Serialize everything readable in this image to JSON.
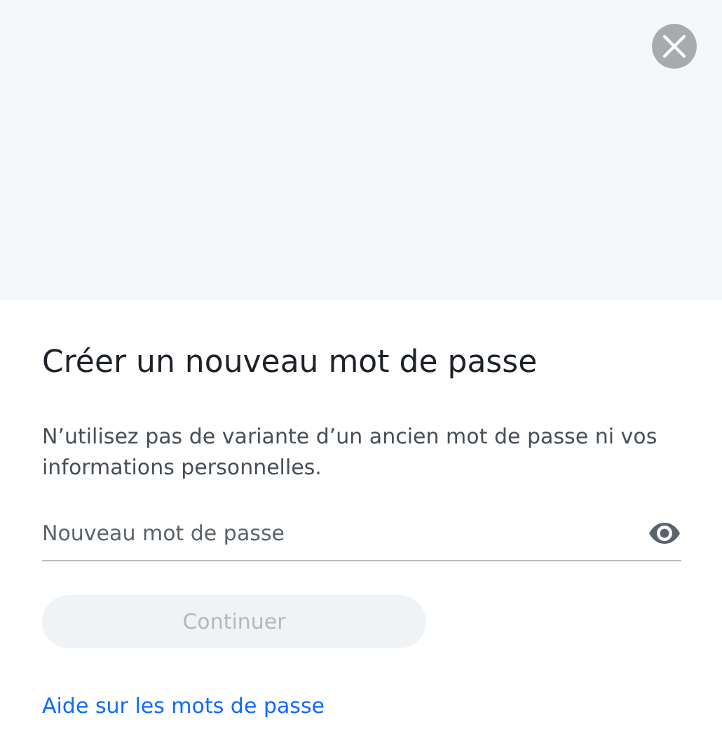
{
  "title": "Créer un nouveau mot de passe",
  "description": "N’utilisez pas de variante d’un ancien mot de passe ni vos informations personnelles.",
  "password_field": {
    "placeholder": "Nouveau mot de passe"
  },
  "continue_button": {
    "label": "Continuer",
    "disabled": true
  },
  "help_link": "Aide sur les mots de passe"
}
